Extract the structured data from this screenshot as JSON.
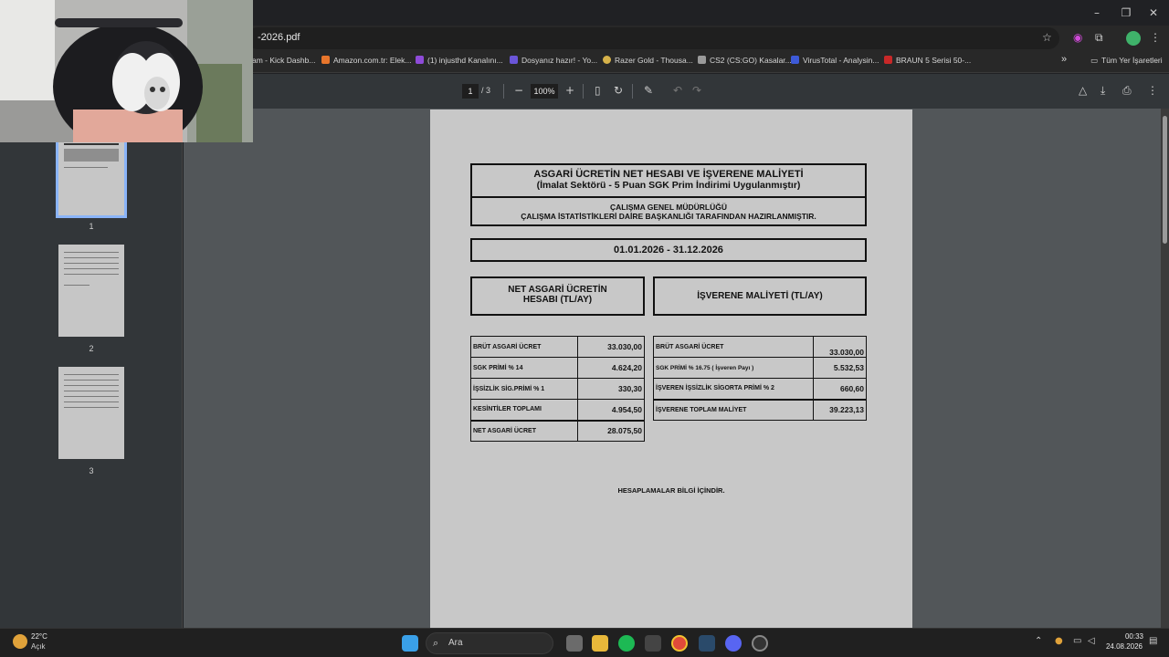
{
  "browser": {
    "url_text": "-2026.pdf",
    "window_controls": {
      "minimize": "–",
      "maximize": "❐",
      "close": "✕"
    }
  },
  "bookmarks": [
    {
      "label": "am - Kick Dashb...",
      "color": ""
    },
    {
      "label": "Amazon.com.tr: Elek...",
      "color": "#e8762c"
    },
    {
      "label": "(1) injusthd Kanalını...",
      "color": "#8e4bd8"
    },
    {
      "label": "Dosyanız hazır! - Yo...",
      "color": "#6a55d8"
    },
    {
      "label": "Razer Gold - Thousa...",
      "color": "#d6b24a"
    },
    {
      "label": "CS2 (CS:GO) Kasalar...",
      "color": "#9a9a9a"
    },
    {
      "label": "VirusTotal - Analysin...",
      "color": "#3d5ad8"
    },
    {
      "label": "BRAUN 5 Serisi 50-...",
      "color": "#c82828"
    }
  ],
  "bookmarks_more": "»",
  "all_bookmarks": "Tüm Yer İşaretleri",
  "pdf_toolbar": {
    "page_current": "1",
    "page_total": "/ 3",
    "zoom": "100%"
  },
  "thumbnails": [
    {
      "num": "1",
      "active": true
    },
    {
      "num": "2",
      "active": false
    },
    {
      "num": "3",
      "active": false
    }
  ],
  "document": {
    "title_line1": "ASGARİ ÜCRETİN NET HESABI VE İŞVERENE MALİYETİ",
    "title_line2": "(İmalat Sektörü - 5 Puan SGK Prim İndirimi Uygulanmıştır)",
    "org_line1": "ÇALIŞMA GENEL MÜDÜRLÜĞÜ",
    "org_line2": "ÇALIŞMA İSTATİSTİKLERİ DAİRE BAŞKANLIĞI TARAFINDAN HAZIRLANMIŞTIR.",
    "period": "01.01.2026 - 31.12.2026",
    "net_header_line1": "NET ASGARİ ÜCRETİN",
    "net_header_line2": "HESABI (TL/AY)",
    "employer_header": "İŞVERENE MALİYETİ (TL/AY)",
    "net_rows": [
      {
        "label": "BRÜT ASGARİ ÜCRET",
        "value": "33.030,00"
      },
      {
        "label": "SGK PRİMİ % 14",
        "value": "4.624,20"
      },
      {
        "label": "İŞSİZLİK SİG.PRİMİ  % 1",
        "value": "330,30"
      },
      {
        "label": "KESİNTİLER TOPLAMI",
        "value": "4.954,50"
      },
      {
        "label": "NET ASGARİ ÜCRET",
        "value": "28.075,50"
      }
    ],
    "employer_rows": [
      {
        "label": "BRÜT ASGARİ ÜCRET",
        "value": "33.030,00"
      },
      {
        "label": "SGK PRİMİ % 16.75 ( İşveren Payı )",
        "value": "5.532,53"
      },
      {
        "label": "İŞVEREN İŞSİZLİK SİGORTA PRİMİ % 2",
        "value": "660,60"
      },
      {
        "label": "İŞVERENE TOPLAM  MALİYET",
        "value": "39.223,13"
      }
    ],
    "info_text": "HESAPLAMALAR BİLGİ İÇİNDİR."
  },
  "taskbar": {
    "weather_temp": "22°C",
    "weather_desc": "Açık",
    "search_placeholder": "Ara",
    "time": "00:33",
    "date": "24.08.2026"
  }
}
